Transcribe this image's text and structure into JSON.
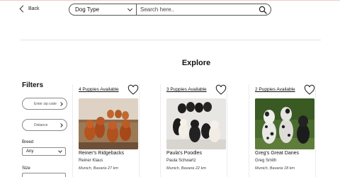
{
  "nav": {
    "back_label": "Back"
  },
  "search": {
    "dog_type_label": "Dog Type",
    "placeholder": "Search here..",
    "value": ""
  },
  "main": {
    "title": "Explore"
  },
  "filters": {
    "title": "Filters",
    "zip_label": "Enter zip code",
    "distance_label": "Distance",
    "breed_label": "Breed",
    "breed_value": "Any",
    "size_label": "Size"
  },
  "cards": [
    {
      "available": "4 Puppies Available",
      "name": "Reiner's Ridgebacks",
      "owner": "Reiner Klaus",
      "location": "Munich, Bavaria 27 km",
      "photo": "red-puppies-photo"
    },
    {
      "available": "3 Puppies Available",
      "name": "Paula's Poodles",
      "owner": "Paula Schwartz",
      "location": "Munich, Bavaria 22 km",
      "photo": "poodle-puppies-photo"
    },
    {
      "available": "2 Puppies Available",
      "name": "Greg's Great Danes",
      "owner": "Greg Smith",
      "location": "Munich, Bavaria 18 km",
      "photo": "great-dane-puppies-photo"
    }
  ],
  "colors": {
    "accent_line": "#f2c9c9",
    "border": "#555555",
    "text": "#111111"
  },
  "icons": {
    "back": "chevron-left-icon",
    "dropdown": "chevron-down-icon",
    "search": "search-icon",
    "favorite": "heart-icon"
  }
}
